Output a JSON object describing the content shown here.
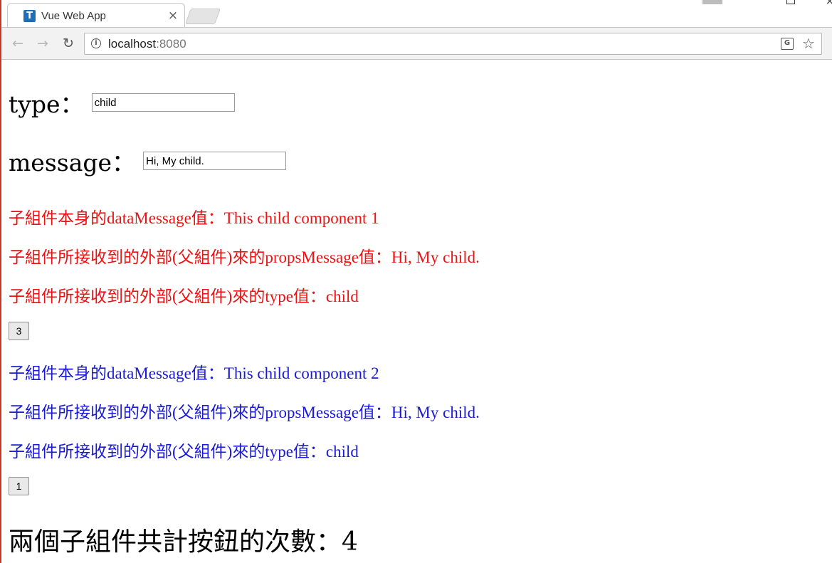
{
  "browser": {
    "tab_title": "Vue Web App",
    "favicon_letter": "T",
    "close_glyph": "×",
    "url_host": "localhost",
    "url_port": ":8080",
    "nav_back_glyph": "←",
    "nav_forward_glyph": "→",
    "reload_glyph": "↻",
    "info_glyph": "i",
    "translate_glyph": "G",
    "star_glyph": "☆"
  },
  "form": {
    "type_label": "type：",
    "type_value": "child",
    "message_label": "message：",
    "message_value": "Hi, My child."
  },
  "child1": {
    "color": "#ee1111",
    "data_message_line": "子組件本身的dataMessage值：This child component 1",
    "props_message_line": "子組件所接收到的外部(父組件)來的propsMessage值：Hi, My child.",
    "type_line": "子組件所接收到的外部(父組件)來的type值：child",
    "button_count": "3"
  },
  "child2": {
    "color": "#1a1ad8",
    "data_message_line": "子組件本身的dataMessage值：This child component 2",
    "props_message_line": "子組件所接收到的外部(父組件)來的propsMessage值：Hi, My child.",
    "type_line": "子組件所接收到的外部(父組件)來的type值：child",
    "button_count": "1"
  },
  "total_line": "兩個子組件共計按鈕的次數：4"
}
